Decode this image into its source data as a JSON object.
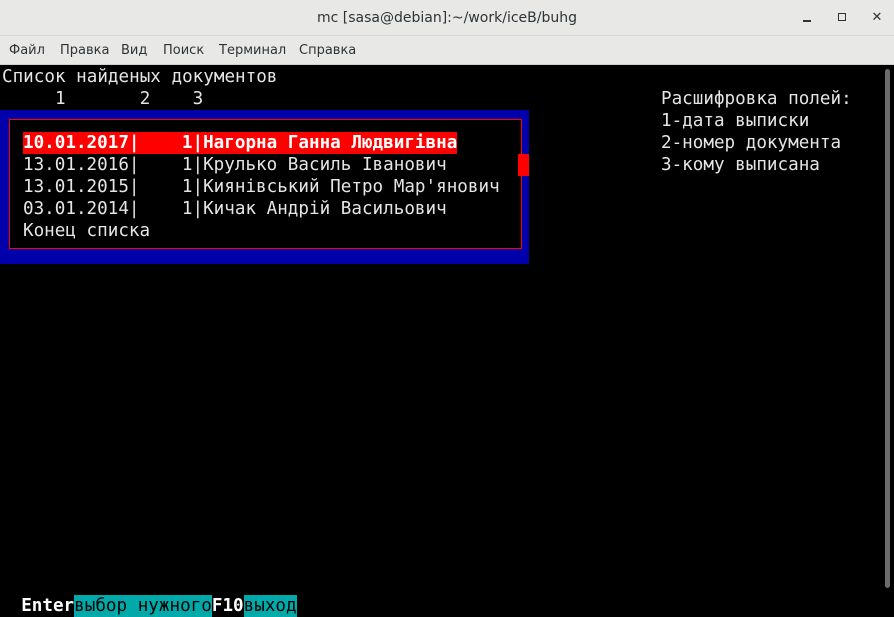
{
  "window": {
    "title": "mc [sasa@debian]:~/work/iceB/buhg",
    "controls": {
      "minimize": "minimize-icon",
      "maximize": "maximize-icon",
      "close": "close-icon"
    }
  },
  "menu": [
    "Файл",
    "Правка",
    "Вид",
    "Поиск",
    "Терминал",
    "Справка"
  ],
  "terminal": {
    "heading": "Список найденых документов",
    "column_numbers": "     1       2    3",
    "legend": {
      "title": "Расшифровка полей:",
      "items": [
        "1-дата выписки",
        "2-номер документа",
        "3-кому выписана"
      ]
    },
    "list": {
      "rows": [
        "10.01.2017|    1|Нагорна Ганна Людвигівна",
        "13.01.2016|    1|Крулько Василь Іванович",
        "13.01.2015|    1|Киянівський Петро Мар'янович",
        "03.01.2014|    1|Кичак Андрій Васильович"
      ],
      "end": "Конец списка",
      "selected_index": 0
    },
    "fkeys": [
      {
        "key": "Enter",
        "label": "выбор нужного"
      },
      {
        "key": "F10",
        "label": "выход"
      }
    ]
  },
  "colors": {
    "selection": "#ff0000",
    "frame": "#0000aa",
    "fkey_label_bg": "#00aaaa"
  }
}
